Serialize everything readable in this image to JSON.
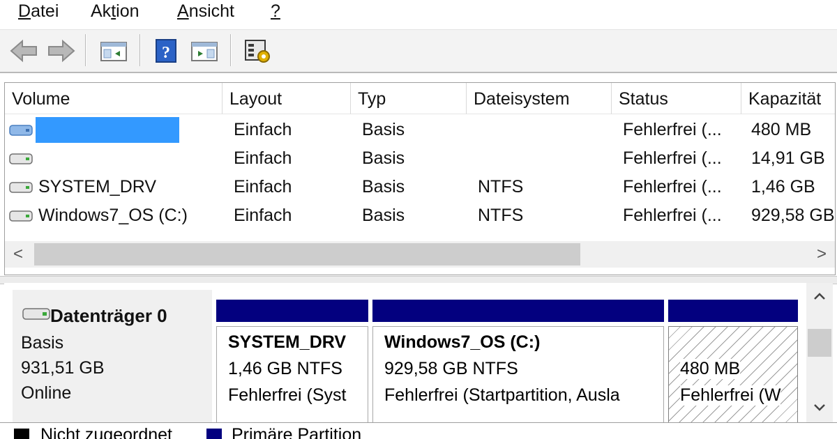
{
  "menu": {
    "items": [
      {
        "label": "Datei",
        "accel": "D",
        "rest": "atei"
      },
      {
        "label": "Aktion",
        "pre": "Ak",
        "accel": "t",
        "rest": "ion"
      },
      {
        "label": "Ansicht",
        "accel": "A",
        "rest": "nsicht"
      },
      {
        "label": "?",
        "accel": "?",
        "rest": ""
      }
    ]
  },
  "toolbar": {
    "buttons": [
      "back-arrow-icon",
      "forward-arrow-icon",
      "show-hide-console-tree-icon",
      "help-icon",
      "show-action-pane-icon",
      "properties-icon"
    ]
  },
  "volume_list": {
    "columns": [
      "Volume",
      "Layout",
      "Typ",
      "Dateisystem",
      "Status",
      "Kapazität"
    ],
    "rows": [
      {
        "volume": "",
        "layout": "Einfach",
        "typ": "Basis",
        "fs": "",
        "status": "Fehlerfrei (...",
        "capacity": "480 MB"
      },
      {
        "volume": "",
        "layout": "Einfach",
        "typ": "Basis",
        "fs": "",
        "status": "Fehlerfrei (...",
        "capacity": "14,91 GB"
      },
      {
        "volume": "SYSTEM_DRV",
        "layout": "Einfach",
        "typ": "Basis",
        "fs": "NTFS",
        "status": "Fehlerfrei (...",
        "capacity": "1,46 GB"
      },
      {
        "volume": "Windows7_OS (C:)",
        "layout": "Einfach",
        "typ": "Basis",
        "fs": "NTFS",
        "status": "Fehlerfrei (...",
        "capacity": "929,58 GB"
      }
    ],
    "scroll_left": "<",
    "scroll_right": ">"
  },
  "disk": {
    "name": "Datenträger 0",
    "type": "Basis",
    "size": "931,51 GB",
    "state": "Online",
    "partitions": [
      {
        "title": "SYSTEM_DRV",
        "line1": "1,46 GB NTFS",
        "line2": "Fehlerfrei (Syst"
      },
      {
        "title": "Windows7_OS  (C:)",
        "line1": "929,58 GB NTFS",
        "line2": "Fehlerfrei (Startpartition, Ausla"
      },
      {
        "title": "",
        "line1": "480 MB",
        "line2": "Fehlerfrei (W"
      }
    ]
  },
  "legend": {
    "unallocated": "Nicht zugeordnet",
    "primary": "Primäre Partition",
    "unallocated_color": "#000000",
    "primary_color": "#03007f"
  }
}
